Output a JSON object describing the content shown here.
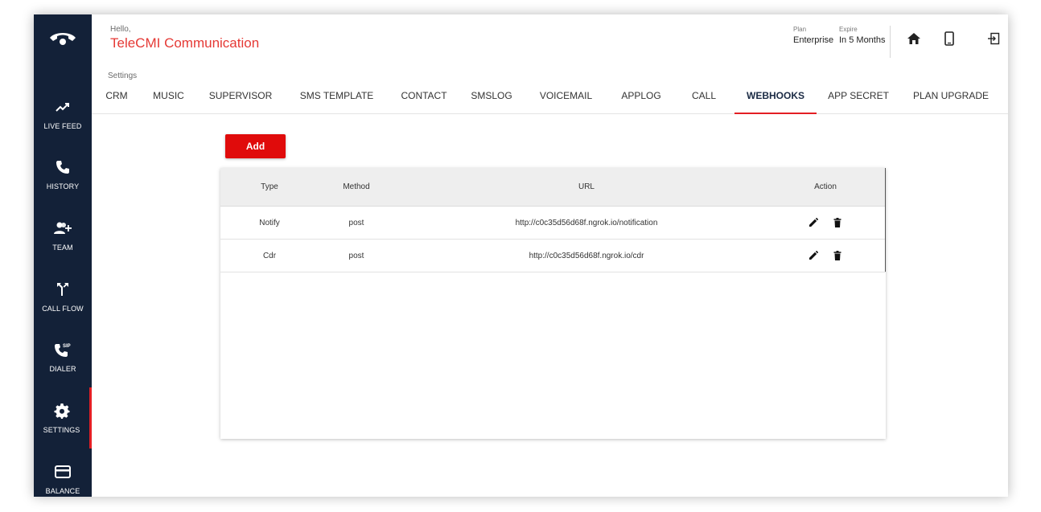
{
  "header": {
    "greeting": "Hello,",
    "company": "TeleCMI Communication",
    "plan_label": "Plan",
    "plan_value": "Enterprise",
    "expire_label": "Expire",
    "expire_value": "In 5 Months",
    "icons": [
      "home-icon",
      "mobile-icon",
      "logout-icon"
    ]
  },
  "sidebar": {
    "logo": "phone-logo-icon",
    "items": [
      {
        "label": "LIVE FEED",
        "icon": "trend-icon"
      },
      {
        "label": "HISTORY",
        "icon": "phone-icon"
      },
      {
        "label": "TEAM",
        "icon": "team-add-icon"
      },
      {
        "label": "CALL FLOW",
        "icon": "call-split-icon"
      },
      {
        "label": "DIALER",
        "icon": "sip-phone-icon"
      },
      {
        "label": "SETTINGS",
        "icon": "gear-icon"
      },
      {
        "label": "BALANCE",
        "icon": "card-icon"
      }
    ],
    "active": "SETTINGS"
  },
  "settings_label": "Settings",
  "tabs": [
    "CRM",
    "MUSIC",
    "SUPERVISOR",
    "SMS TEMPLATE",
    "CONTACT",
    "SMSLOG",
    "VOICEMAIL",
    "APPLOG",
    "CALL",
    "WEBHOOKS",
    "APP SECRET",
    "PLAN UPGRADE"
  ],
  "active_tab": "WEBHOOKS",
  "add_button": "Add",
  "table": {
    "columns": [
      "Type",
      "Method",
      "URL",
      "Action"
    ],
    "rows": [
      {
        "type": "Notify",
        "method": "post",
        "url": "http://c0c35d56d68f.ngrok.io/notification",
        "actions": [
          "edit-icon",
          "delete-icon"
        ]
      },
      {
        "type": "Cdr",
        "method": "post",
        "url": "http://c0c35d56d68f.ngrok.io/cdr",
        "actions": [
          "edit-icon",
          "delete-icon"
        ]
      }
    ]
  },
  "colors": {
    "sidebar": "#132138",
    "accent": "#e31e24",
    "company": "#e53935",
    "button": "#e00b0b"
  }
}
